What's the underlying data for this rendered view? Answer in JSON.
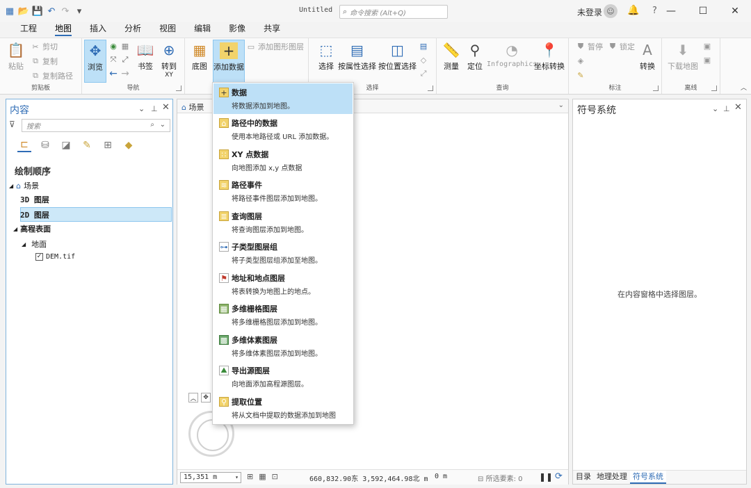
{
  "titlebar": {
    "doc_title": "Untitled",
    "search_placeholder": "命令搜索 (Alt+Q)",
    "user": "未登录",
    "help": "?",
    "window_controls": [
      "—",
      "☐",
      "✕"
    ]
  },
  "tabs": [
    "工程",
    "地图",
    "插入",
    "分析",
    "视图",
    "编辑",
    "影像",
    "共享"
  ],
  "ribbon": {
    "clipboard": {
      "paste": "粘贴",
      "cut": "剪切",
      "copy": "复制",
      "copy_path": "复制路径",
      "label": "剪贴板"
    },
    "navigate": {
      "explore": "浏览",
      "bookmarks": "书签",
      "goto": "转到",
      "goto_sub": "XY",
      "label": "导航"
    },
    "layer": {
      "basemap": "底图",
      "add_data": "添加数据",
      "add_graphics": "添加图形图层"
    },
    "selection": {
      "select": "选择",
      "by_attr": "按属性选择",
      "by_loc": "按位置选择",
      "label": "选择"
    },
    "inquiry": {
      "measure": "测量",
      "locate": "定位",
      "infographics": "Infographics",
      "coord": "坐标转换",
      "label": "查询"
    },
    "labeling": {
      "pause": "暂停",
      "lock": "锁定",
      "convert": "转换",
      "label": "标注"
    },
    "offline": {
      "download": "下载地图",
      "label": "离线"
    }
  },
  "contents": {
    "title": "内容",
    "search_placeholder": "搜索",
    "draw_order": "绘制顺序",
    "scene": "场景",
    "layer3d": "3D 图层",
    "layer2d": "2D 图层",
    "elevation": "高程表面",
    "ground": "地面",
    "dem": "DEM.tif"
  },
  "map": {
    "tab_label": "场景",
    "scale": "15,351 m",
    "coords": "660,832.90东 3,592,464.98北 m",
    "z": "0 m",
    "selected": "所选要素: 0"
  },
  "symbology": {
    "title": "符号系统",
    "message": "在内容窗格中选择图层。",
    "tabs": [
      "目录",
      "地理处理",
      "符号系统"
    ]
  },
  "add_data_menu": [
    {
      "title": "数据",
      "desc": "将数据添加到地图。",
      "icon": "add-data-icon"
    },
    {
      "title": "路径中的数据",
      "desc": "使用本地路径或 URL 添加数据。",
      "icon": "path-data-icon"
    },
    {
      "title": "XY 点数据",
      "desc": "向地图添加 x,y 点数据",
      "icon": "xy-point-icon"
    },
    {
      "title": "路径事件",
      "desc": "将路径事件图层添加到地图。",
      "icon": "route-event-icon"
    },
    {
      "title": "查询图层",
      "desc": "将查询图层添加到地图。",
      "icon": "query-layer-icon"
    },
    {
      "title": "子类型图层组",
      "desc": "将子类型图层组添加至地图。",
      "icon": "subtype-group-icon"
    },
    {
      "title": "地址和地点图层",
      "desc": "将表转换为地图上的地点。",
      "icon": "address-layer-icon"
    },
    {
      "title": "多维栅格图层",
      "desc": "将多维栅格图层添加到地图。",
      "icon": "md-raster-icon"
    },
    {
      "title": "多维体素图层",
      "desc": "将多维体素图层添加到地图。",
      "icon": "md-voxel-icon"
    },
    {
      "title": "导出源图层",
      "desc": "向地面添加高程源图层。",
      "icon": "elevation-source-icon"
    },
    {
      "title": "提取位置",
      "desc": "将从文档中提取的数据添加到地图",
      "icon": "extract-location-icon"
    }
  ],
  "colors": {
    "accent": "#2f6cb5",
    "highlight": "#bde0f7"
  }
}
